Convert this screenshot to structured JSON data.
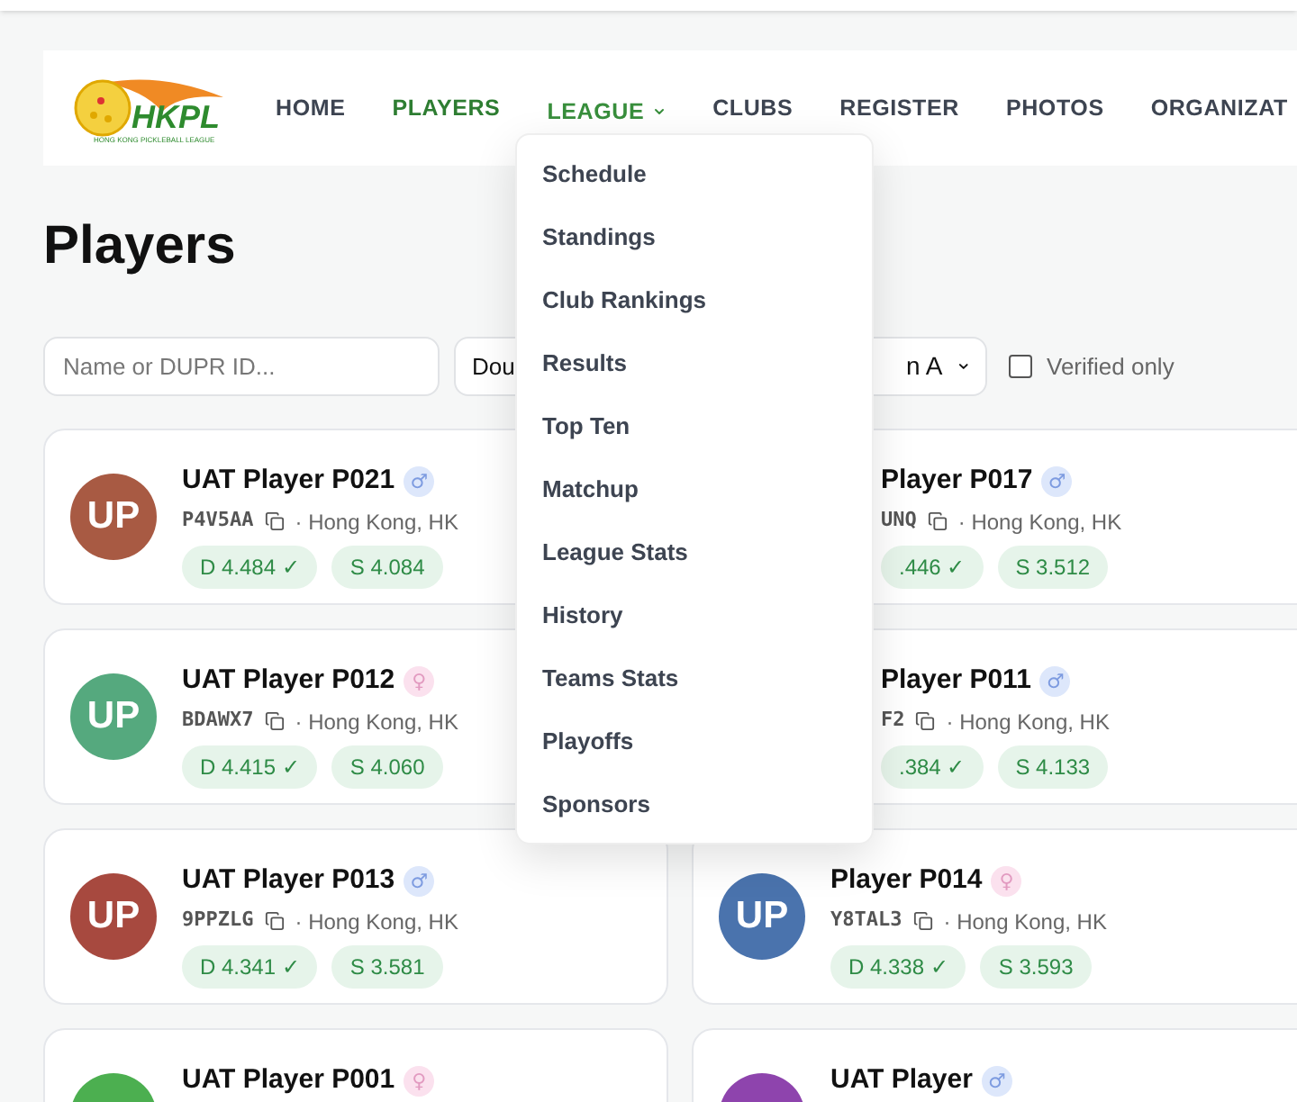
{
  "logo": {
    "text": "HKPL",
    "subtitle": "HONG KONG PICKLEBALL LEAGUE"
  },
  "nav": [
    {
      "label": "HOME",
      "selected": false
    },
    {
      "label": "PLAYERS",
      "selected": true
    },
    {
      "label": "LEAGUE",
      "selected": false,
      "expanded": true
    },
    {
      "label": "CLUBS",
      "selected": false
    },
    {
      "label": "REGISTER",
      "selected": false
    },
    {
      "label": "PHOTOS",
      "selected": false
    },
    {
      "label": "ORGANIZAT",
      "selected": false
    }
  ],
  "league_menu": [
    "Schedule",
    "Standings",
    "Club Rankings",
    "Results",
    "Top Ten",
    "Matchup",
    "League Stats",
    "History",
    "Teams Stats",
    "Playoffs",
    "Sponsors"
  ],
  "page_title": "Players",
  "filters": {
    "search": {
      "placeholder": "Name or DUPR ID..."
    },
    "select_1": "Dou",
    "select_2": "n A",
    "verified_only": {
      "label": "Verified only",
      "checked": false
    }
  },
  "players": [
    {
      "kind": "full",
      "avatar": "UP",
      "color": "#a85a43",
      "name": "UAT Player P021",
      "gender": "♂",
      "id": "P4V5AA",
      "location": "· Hong Kong, HK",
      "doubles": "D 4.484 ✓",
      "singles": "S 4.084"
    },
    {
      "kind": "covered",
      "name": "Player P017",
      "gender": "♂",
      "id": "UNQ",
      "location": "· Hong Kong, HK",
      "doubles": ".446 ✓",
      "singles": "S 3.512"
    },
    {
      "kind": "full",
      "avatar": "UP",
      "color": "#55a97e",
      "name": "UAT Player P012",
      "gender": "♀",
      "id": "BDAWX7",
      "location": "· Hong Kong, HK",
      "doubles": "D 4.415 ✓",
      "singles": "S 4.060"
    },
    {
      "kind": "covered",
      "name": "Player P011",
      "gender": "♂",
      "id": "F2",
      "location": "· Hong Kong, HK",
      "doubles": ".384 ✓",
      "singles": "S 4.133"
    },
    {
      "kind": "full",
      "avatar": "UP",
      "color": "#a7493f",
      "name": "UAT Player P013",
      "gender": "♂",
      "id": "9PPZLG",
      "location": "· Hong Kong, HK",
      "doubles": "D 4.341 ✓",
      "singles": "S 3.581"
    },
    {
      "kind": "full",
      "avatar": "UP",
      "color": "#4a73ad",
      "name": "Player P014",
      "gender": "♀",
      "id": "Y8TAL3",
      "location": "· Hong Kong, HK",
      "doubles": "D 4.338 ✓",
      "singles": "S 3.593"
    },
    {
      "kind": "full",
      "color": "#4caf50",
      "name": "UAT Player P001",
      "gender": "♀"
    },
    {
      "kind": "full",
      "color": "#8e44ad",
      "name": "UAT Player",
      "gender": "♂"
    }
  ]
}
